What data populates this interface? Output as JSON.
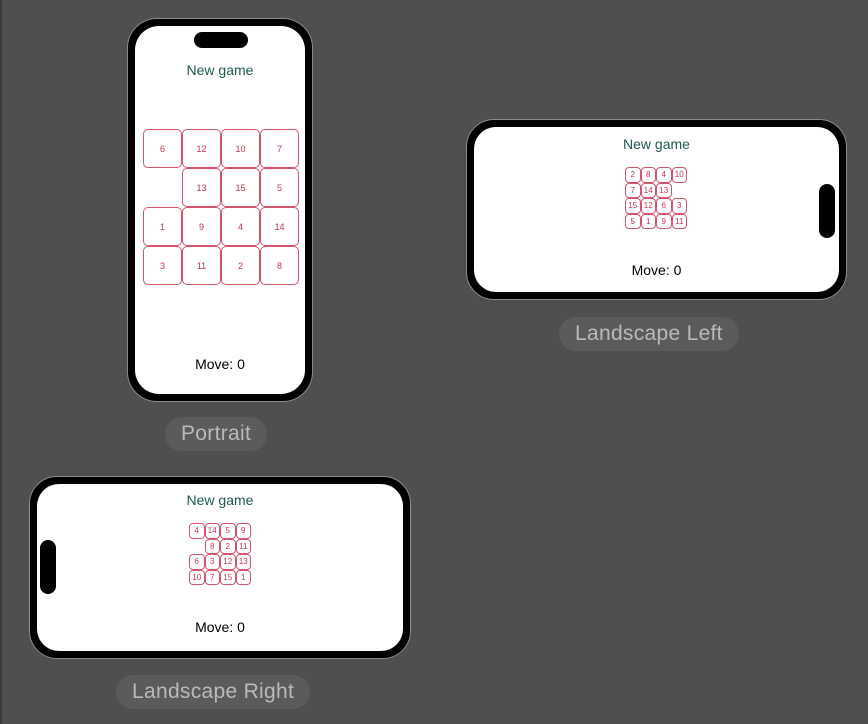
{
  "canvas": {
    "devices": [
      {
        "id": "portrait",
        "label": "Portrait",
        "new_game": "New game",
        "move_text": "Move: 0",
        "tiles": [
          "6",
          "12",
          "10",
          "7",
          "",
          "13",
          "15",
          "5",
          "1",
          "9",
          "4",
          "14",
          "3",
          "11",
          "2",
          "8"
        ]
      },
      {
        "id": "land-left",
        "label": "Landscape Left",
        "new_game": "New game",
        "move_text": "Move: 0",
        "tiles": [
          "2",
          "8",
          "4",
          "10",
          "7",
          "14",
          "13",
          "",
          "15",
          "12",
          "6",
          "3",
          "5",
          "1",
          "9",
          "11"
        ]
      },
      {
        "id": "land-right",
        "label": "Landscape Right",
        "new_game": "New game",
        "move_text": "Move: 0",
        "tiles": [
          "4",
          "14",
          "5",
          "9",
          "",
          "8",
          "2",
          "11",
          "6",
          "3",
          "12",
          "13",
          "10",
          "7",
          "15",
          "1"
        ]
      }
    ]
  },
  "colors": {
    "background": "#4f4f4f",
    "title_text": "#1e5a52",
    "tile_border": "#d2556b",
    "tile_text": "#c8344f",
    "label_pill": "#5b5b5b",
    "label_text": "#b9b9b9"
  }
}
